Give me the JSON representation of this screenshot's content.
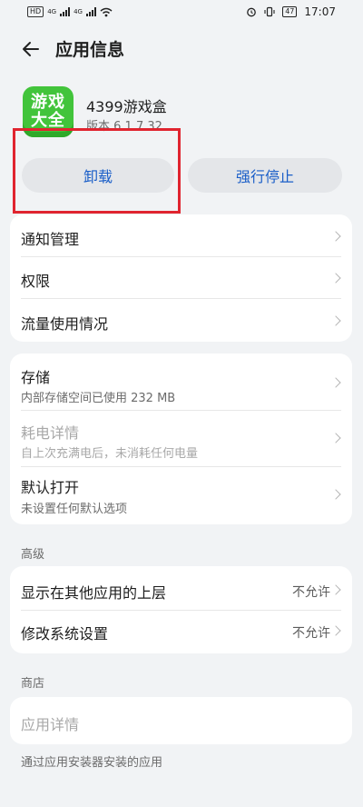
{
  "status_bar": {
    "left_chip": "HD",
    "sim1": "4G",
    "sim2": "4G",
    "time": "17:07",
    "battery": "47"
  },
  "header": {
    "title": "应用信息"
  },
  "app": {
    "icon_text_line1": "游戏",
    "icon_text_line2": "大全",
    "name": "4399游戏盒",
    "version": "版本 6.1.7.32"
  },
  "buttons": {
    "uninstall": "卸载",
    "force_stop": "强行停止"
  },
  "card1": {
    "items": [
      {
        "label": "通知管理"
      },
      {
        "label": "权限"
      },
      {
        "label": "流量使用情况"
      }
    ]
  },
  "card2": {
    "items": [
      {
        "label": "存储",
        "sub": "内部存储空间已使用 232 MB"
      },
      {
        "label": "耗电详情",
        "sub": "自上次充满电后，未消耗任何电量"
      },
      {
        "label": "默认打开",
        "sub": "未设置任何默认选项"
      }
    ]
  },
  "advanced": {
    "title": "高级",
    "items": [
      {
        "label": "显示在其他应用的上层",
        "value": "不允许"
      },
      {
        "label": "修改系统设置",
        "value": "不允许"
      }
    ]
  },
  "store": {
    "title": "商店",
    "item": "应用详情",
    "note": "通过应用安装器安装的应用"
  },
  "colors": {
    "accent": "#1a5ec8",
    "highlight": "#e0242f",
    "icon_bg": "#42c43b"
  }
}
